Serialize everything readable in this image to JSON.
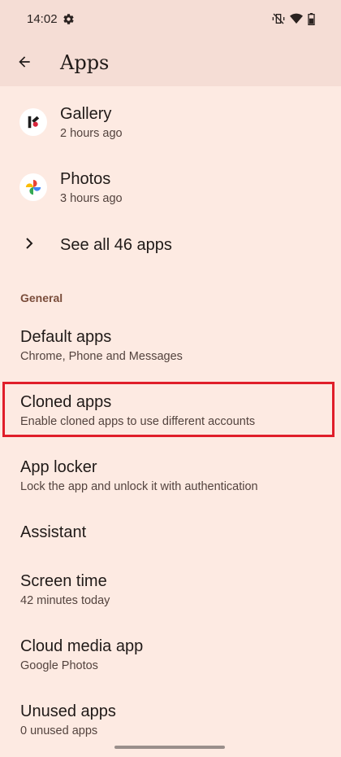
{
  "status_bar": {
    "time": "14:02",
    "icons": [
      "gear-icon",
      "vibrate-off-icon",
      "wifi-icon",
      "battery-icon"
    ]
  },
  "app_bar": {
    "title": "Apps",
    "back_icon": "arrow-back-icon"
  },
  "recent_apps": [
    {
      "name": "Gallery",
      "time": "2 hours ago",
      "icon": "gallery-icon"
    },
    {
      "name": "Photos",
      "time": "3 hours ago",
      "icon": "google-photos-icon"
    }
  ],
  "see_all": {
    "label": "See all 46 apps",
    "icon": "chevron-right-icon"
  },
  "general": {
    "header": "General",
    "items": [
      {
        "title": "Default apps",
        "subtitle": "Chrome, Phone and Messages"
      },
      {
        "title": "Cloned apps",
        "subtitle": "Enable cloned apps to use different accounts"
      },
      {
        "title": "App locker",
        "subtitle": "Lock the app and unlock it with authentication"
      },
      {
        "title": "Assistant"
      },
      {
        "title": "Screen time",
        "subtitle": "42 minutes today"
      },
      {
        "title": "Cloud media app",
        "subtitle": "Google Photos"
      },
      {
        "title": "Unused apps",
        "subtitle": "0 unused apps"
      }
    ]
  },
  "colors": {
    "background": "#fdeae2",
    "app_bar": "#f5ddd5",
    "section_header": "#7a4d3b",
    "highlight_border": "#e01e2a"
  }
}
